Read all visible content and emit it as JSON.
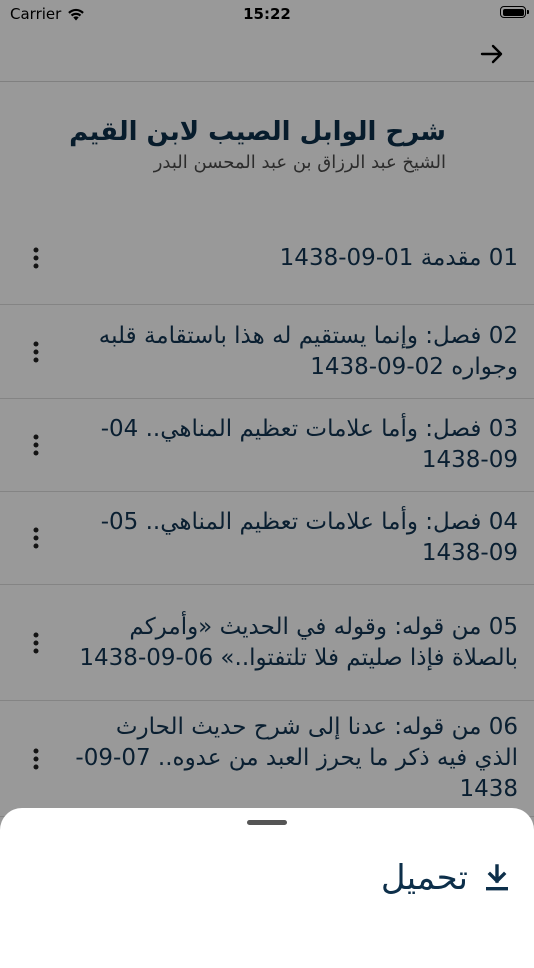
{
  "status_bar": {
    "carrier": "Carrier",
    "time": "15:22"
  },
  "book": {
    "title": "شرح الوابل الصيب لابن القيم",
    "author": "الشيخ عبد الرزاق بن عبد المحسن البدر"
  },
  "lessons": [
    {
      "title": "01 مقدمة 01-09-1438"
    },
    {
      "title": "02 فصل: وإنما يستقيم له هذا باستقامة قلبه وجواره 02-09-1438"
    },
    {
      "title": "03 فصل: وأما علامات تعظيم المناهي.. 04-09-1438"
    },
    {
      "title": "04 فصل: وأما علامات تعظيم المناهي.. 05-09-1438"
    },
    {
      "title": "05 من قوله: وقوله في الحديث «وأمركم بالصلاة فإذا صليتم فلا تلتفتوا..» 06-09-1438"
    },
    {
      "title": "06 من قوله: عدنا إلى شرح حديث الحارث الذي فيه ذكر ما يحرز العبد من عدوه.. 07-09-1438"
    }
  ],
  "sheet": {
    "download_label": "تحميل"
  }
}
